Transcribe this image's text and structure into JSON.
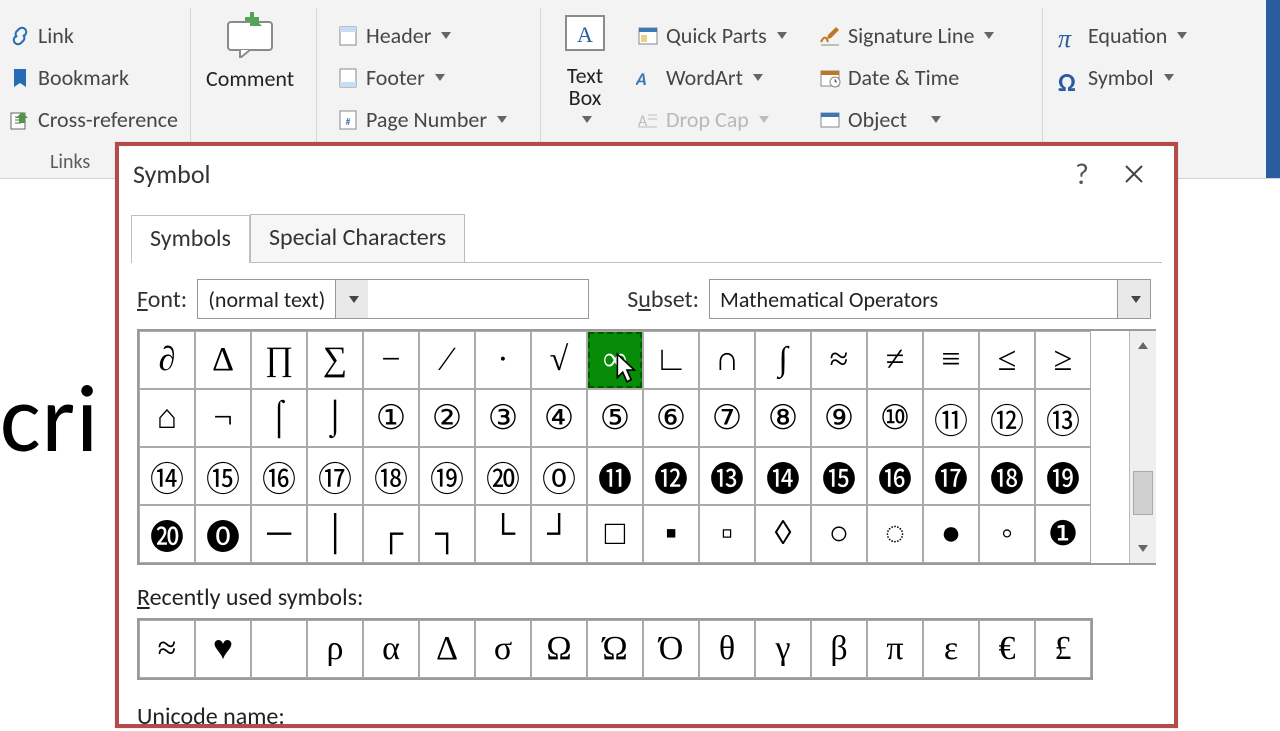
{
  "ribbon": {
    "links": {
      "link": "Link",
      "bookmark": "Bookmark",
      "crossref": "Cross-reference",
      "group": "Links"
    },
    "comment": "Comment",
    "hf": {
      "header": "Header",
      "footer": "Footer",
      "pagenum": "Page Number"
    },
    "text": {
      "textbox": "Text\nBox",
      "quickparts": "Quick Parts",
      "wordart": "WordArt",
      "dropcap": "Drop Cap",
      "sigline": "Signature Line",
      "datetime": "Date & Time",
      "object": "Object"
    },
    "sym": {
      "equation": "Equation",
      "symbol": "Symbol"
    }
  },
  "document_fragment": "cri",
  "dialog": {
    "title": "Symbol",
    "tabs": {
      "symbols": "Symbols",
      "special": "Special Characters"
    },
    "font_label": "Font:",
    "font_value": "(normal text)",
    "subset_label": "Subset:",
    "subset_value": "Mathematical Operators",
    "grid": [
      [
        "∂",
        "Δ",
        "∏",
        "∑",
        "−",
        "∕",
        "∙",
        "√",
        "∞",
        "∟",
        "∩",
        "∫",
        "≈",
        "≠",
        "≡",
        "≤",
        "≥"
      ],
      [
        "⌂",
        "¬",
        "⌠",
        "⌡",
        "①",
        "②",
        "③",
        "④",
        "⑤",
        "⑥",
        "⑦",
        "⑧",
        "⑨",
        "⑩",
        "⑪",
        "⑫",
        "⑬"
      ],
      [
        "⑭",
        "⑮",
        "⑯",
        "⑰",
        "⑱",
        "⑲",
        "⑳",
        "⓪",
        "⓫",
        "⓬",
        "⓭",
        "⓮",
        "⓯",
        "⓰",
        "⓱",
        "⓲",
        "⓳"
      ],
      [
        "⓴",
        "⓿",
        "─",
        "│",
        "┌",
        "┐",
        "└",
        "┘",
        "□",
        "▪",
        "▫",
        "◊",
        "○",
        "◌",
        "●",
        "◦",
        "❶"
      ]
    ],
    "selected": {
      "row": 0,
      "col": 8
    },
    "recent_label": "Recently used symbols:",
    "recent": [
      "≈",
      "♥",
      "",
      "ρ",
      "α",
      "Δ",
      "σ",
      "Ω",
      "Ώ",
      "Ό",
      "θ",
      "γ",
      "β",
      "π",
      "ε",
      "€",
      "£"
    ],
    "unicode_label": "Unicode name:"
  },
  "chart_data": null
}
